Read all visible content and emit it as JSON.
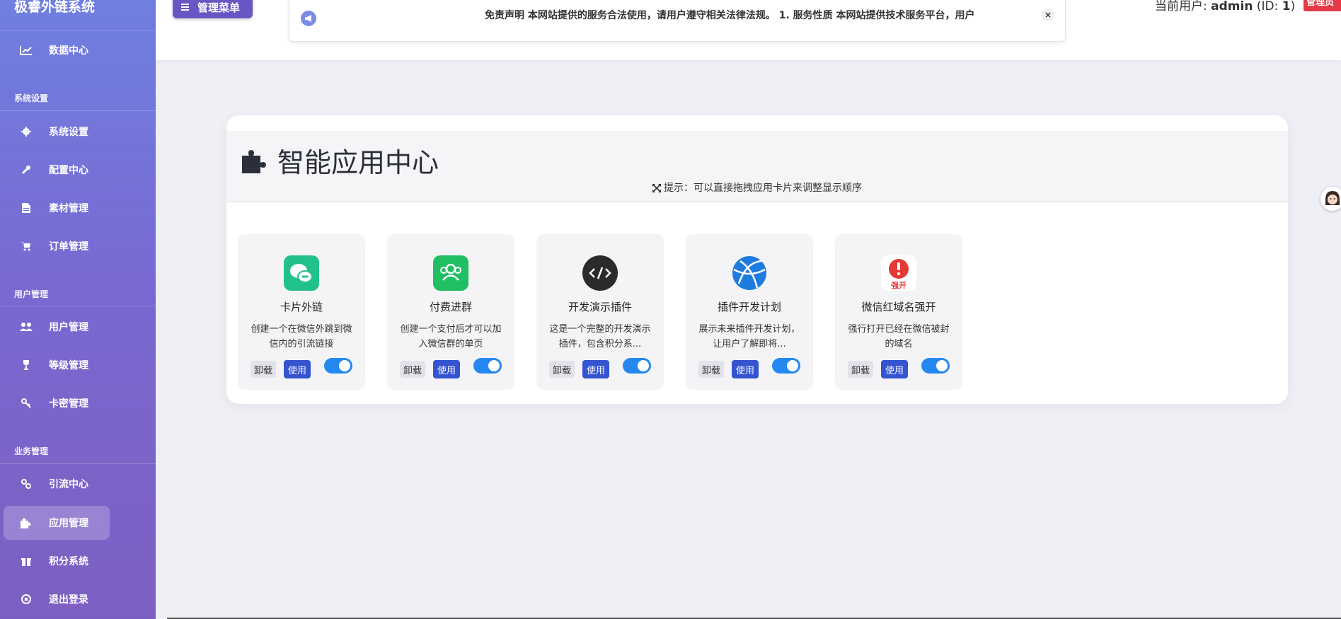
{
  "brand": {
    "title": "极睿外链系统"
  },
  "sidebar": {
    "items": [
      {
        "label": "数据中心",
        "icon": "chart-line-icon"
      },
      {
        "label": "系统设置",
        "icon": "gear-icon"
      },
      {
        "label": "配置中心",
        "icon": "wrench-icon"
      },
      {
        "label": "素材管理",
        "icon": "file-icon"
      },
      {
        "label": "订单管理",
        "icon": "cart-icon"
      },
      {
        "label": "用户管理",
        "icon": "users-icon"
      },
      {
        "label": "等级管理",
        "icon": "trophy-icon"
      },
      {
        "label": "卡密管理",
        "icon": "key-icon"
      },
      {
        "label": "引流中心",
        "icon": "link-icon"
      },
      {
        "label": "应用管理",
        "icon": "puzzle-icon",
        "active": true
      },
      {
        "label": "积分系统",
        "icon": "gift-icon"
      },
      {
        "label": "退出登录",
        "icon": "logout-icon"
      }
    ],
    "sections": [
      "系统设置",
      "用户管理",
      "业务管理"
    ]
  },
  "header": {
    "menu_label": "管理菜单",
    "notice": "免责声明 本网站提供的服务合法使用，请用户遵守相关法律法规。 1. 服务性质 本网站提供技术服务平台，用户",
    "close_symbol": "×",
    "user_prefix": "当前用户: ",
    "username": "admin",
    "user_id_text": " (ID: ",
    "user_id": "1",
    "user_suffix": ")",
    "badge": "管理员"
  },
  "panel": {
    "title": "智能应用中心",
    "hint": "提示：可以直接拖拽应用卡片来调整显示顺序"
  },
  "cards": [
    {
      "title": "卡片外链",
      "desc": "创建一个在微信外跳到微信内的引流链接",
      "uninstall": "卸载",
      "use": "使用",
      "enabled": true,
      "icon": "wechat-link-icon",
      "color": "#22c08b"
    },
    {
      "title": "付费进群",
      "desc": "创建一个支付后才可以加入微信群的单页",
      "uninstall": "卸载",
      "use": "使用",
      "enabled": true,
      "icon": "group-icon",
      "color": "#1fbf62"
    },
    {
      "title": "开发演示插件",
      "desc": "这是一个完整的开发演示插件，包含积分系...",
      "uninstall": "卸载",
      "use": "使用",
      "enabled": true,
      "icon": "code-icon",
      "color": "#2b2b2b"
    },
    {
      "title": "插件开发计划",
      "desc": "展示未来插件开发计划，让用户了解即将...",
      "uninstall": "卸载",
      "use": "使用",
      "enabled": true,
      "icon": "globe-icon",
      "color": "#1e7be0"
    },
    {
      "title": "微信红域名强开",
      "desc": "强行打开已经在微信被封的域名",
      "uninstall": "卸载",
      "use": "使用",
      "enabled": true,
      "icon": "alert-open-icon",
      "color": "#e53935",
      "icon_text": "强开"
    }
  ]
}
